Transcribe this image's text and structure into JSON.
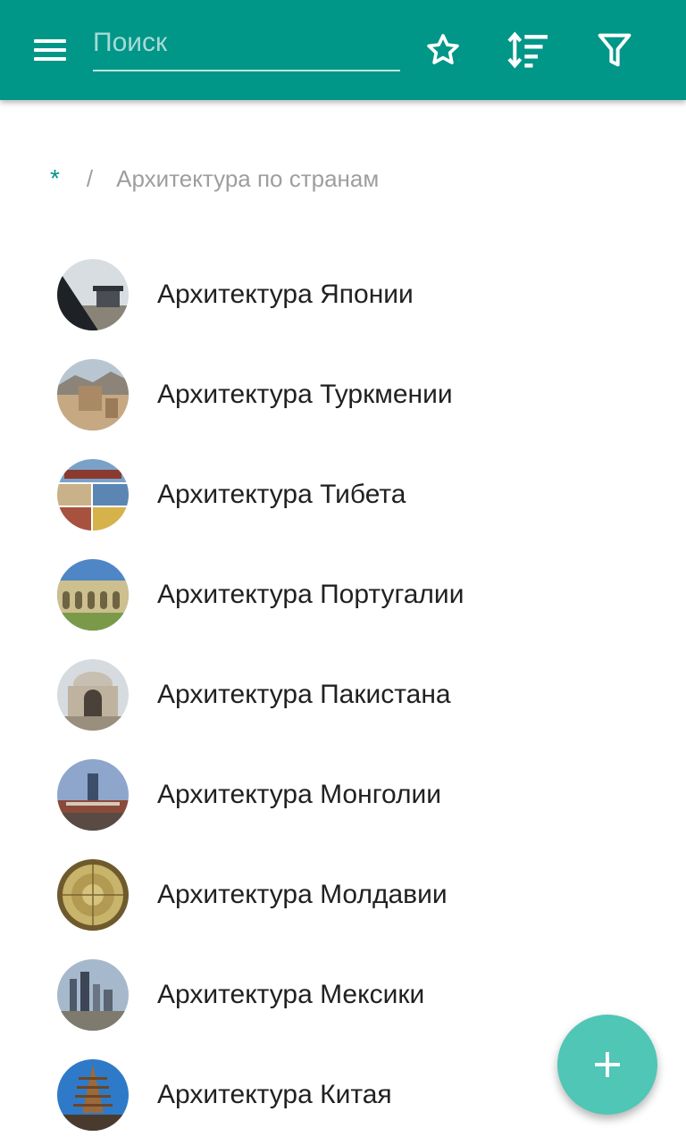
{
  "toolbar": {
    "menu_icon": "hamburger-menu-icon",
    "search_placeholder": "Поиск",
    "search_value": "",
    "favorites_icon": "star-outline-icon",
    "sort_icon": "sort-icon",
    "filter_icon": "filter-icon",
    "accent_color": "#009688"
  },
  "breadcrumb": {
    "root": "*",
    "separator": "/",
    "current": "Архитектура по странам"
  },
  "list": {
    "items": [
      {
        "label": "Архитектура Японии"
      },
      {
        "label": "Архитектура Туркмении"
      },
      {
        "label": "Архитектура Тибета"
      },
      {
        "label": "Архитектура Португалии"
      },
      {
        "label": "Архитектура Пакистана"
      },
      {
        "label": "Архитектура Монголии"
      },
      {
        "label": "Архитектура Молдавии"
      },
      {
        "label": "Архитектура Мексики"
      },
      {
        "label": "Архитектура Китая"
      }
    ]
  },
  "fab": {
    "icon": "plus-icon",
    "color": "#4fc6b6"
  }
}
